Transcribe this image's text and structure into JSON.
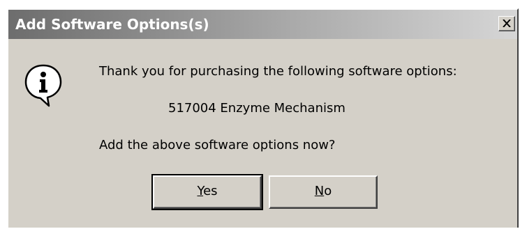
{
  "dialog": {
    "title": "Add Software Options(s)",
    "close_icon": "close-icon",
    "icon": "information-icon"
  },
  "message": {
    "line1": "Thank you for purchasing the following software options:",
    "option": "517004 Enzyme Mechanism",
    "question": "Add the above software options now?"
  },
  "buttons": {
    "yes": {
      "mnemonic": "Y",
      "rest": "es"
    },
    "no": {
      "mnemonic": "N",
      "rest": "o"
    }
  }
}
